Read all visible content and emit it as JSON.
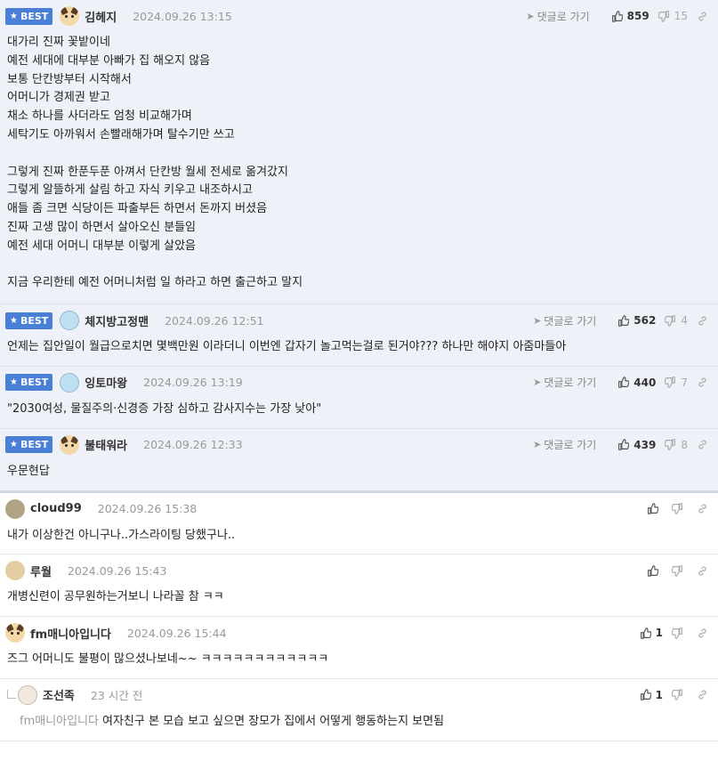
{
  "reply_label": "댓글로 가기",
  "best_label": "BEST",
  "best_comments": [
    {
      "nick": "김헤지",
      "avatar": "dog",
      "date": "2024.09.26 13:15",
      "up": "859",
      "down": "15",
      "body": "대가리 진짜 꽃밭이네\n예전 세대에 대부분 아빠가 집 해오지 않음\n보통 단칸방부터 시작해서\n어머니가 경제권 받고\n채소 하나를 사더라도 엄청 비교해가며\n세탁기도 아까워서 손빨래해가며 탈수기만 쓰고\n\n그렇게 진짜 한푼두푼 아껴서 단칸방 월세 전세로 옮겨갔지\n그렇게 알뜰하게 살림 하고 자식 키우고 내조하시고\n애들 좀 크면 식당이든 파출부든 하면서 돈까지 버셨음\n진짜 고생 많이 하면서 살아오신 분들임\n예전 세대 어머니 대부분 이렇게 살았음\n\n지금 우리한테 예전 어머니처럼 일 하라고 하면 출근하고 말지"
    },
    {
      "nick": "체지방고정맨",
      "avatar": "blue",
      "date": "2024.09.26 12:51",
      "up": "562",
      "down": "4",
      "body": "언제는 집안일이 월급으로치면 몇백만원 이라더니 이번엔 갑자기 놀고먹는걸로 된거야??? 하나만 해야지 아줌마들아"
    },
    {
      "nick": "잉토마왕",
      "avatar": "blue",
      "date": "2024.09.26 13:19",
      "up": "440",
      "down": "7",
      "body": "\"2030여성, 물질주의·신경증 가장 심하고 감사지수는 가장 낮아\""
    },
    {
      "nick": "불태워라",
      "avatar": "dog",
      "date": "2024.09.26 12:33",
      "up": "439",
      "down": "8",
      "body": "우문현답"
    }
  ],
  "comments": [
    {
      "nick": "cloud99",
      "avatar": "circle",
      "date": "2024.09.26 15:38",
      "up": "",
      "body": "내가 이상한건 아니구나..가스라이팅 당했구나.."
    },
    {
      "nick": "루월",
      "avatar": "otter",
      "date": "2024.09.26 15:43",
      "up": "",
      "body": "개병신련이 공무원하는거보니 나라꼴 참 ㅋㅋ"
    },
    {
      "nick": "fm매니아입니다",
      "avatar": "dog",
      "date": "2024.09.26 15:44",
      "up": "1",
      "body": "즈그 어머니도 불평이 많으셨나보네~~ ㅋㅋㅋㅋㅋㅋㅋㅋㅋㅋㅋㅋ"
    }
  ],
  "reply": {
    "nick": "조선족",
    "avatar": "cat",
    "date": "23 시간 전",
    "up": "1",
    "mention": "fm매니아입니다",
    "body": "여자친구 본 모습 보고 싶으면 장모가 집에서 어떻게 행동하는지 보면됨"
  },
  "icons": {
    "thumbs_up": "thumbs-up-icon",
    "thumbs_down": "thumbs-down-icon",
    "link": "link-icon",
    "reply_arrow": "reply-arrow-icon",
    "star": "star-icon"
  },
  "colors": {
    "best_badge": "#4a7fd6",
    "best_bg": "#eef1f7"
  }
}
